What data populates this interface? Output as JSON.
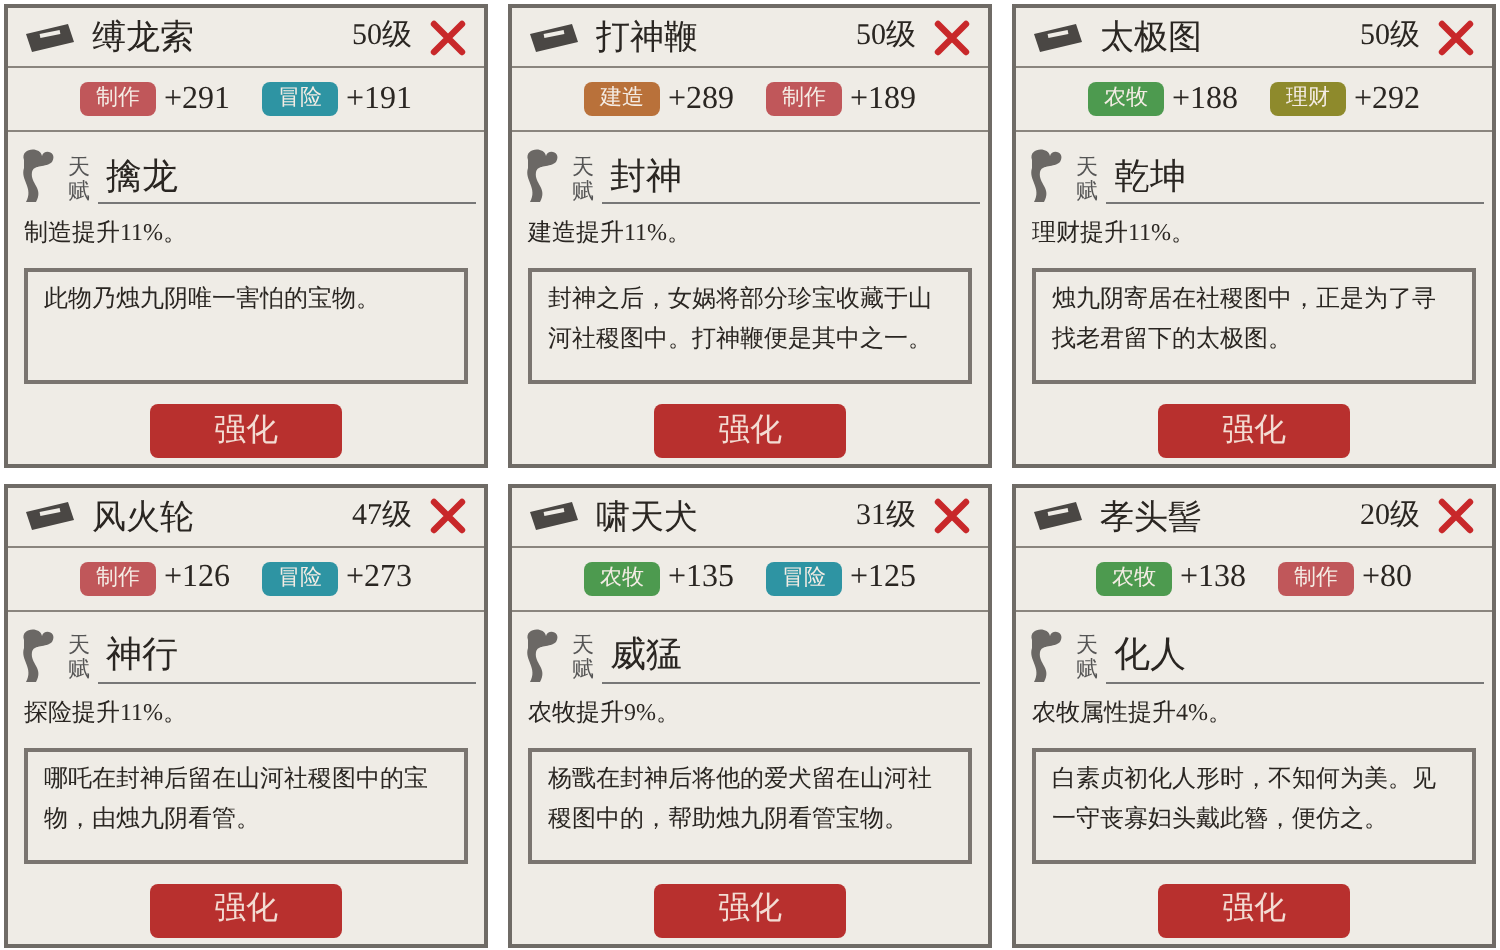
{
  "cards": [
    {
      "name": "缚龙索",
      "level": "50级",
      "tags": [
        {
          "label": "制作",
          "value": "+291",
          "color": "#c0575a"
        },
        {
          "label": "冒险",
          "value": "+191",
          "color": "#2e94a3"
        }
      ],
      "talent_label": "天赋",
      "talent": "擒龙",
      "effect": "制造提升11%。",
      "description": "此物乃烛九阴唯一害怕的宝物。",
      "button": "强化"
    },
    {
      "name": "打神鞭",
      "level": "50级",
      "tags": [
        {
          "label": "建造",
          "value": "+289",
          "color": "#b9713a"
        },
        {
          "label": "制作",
          "value": "+189",
          "color": "#c0575a"
        }
      ],
      "talent_label": "天赋",
      "talent": "封神",
      "effect": "建造提升11%。",
      "description": "封神之后，女娲将部分珍宝收藏于山河社稷图中。打神鞭便是其中之一。",
      "button": "强化"
    },
    {
      "name": "太极图",
      "level": "50级",
      "tags": [
        {
          "label": "农牧",
          "value": "+188",
          "color": "#4d9a4f"
        },
        {
          "label": "理财",
          "value": "+292",
          "color": "#8e8a2c"
        }
      ],
      "talent_label": "天赋",
      "talent": "乾坤",
      "effect": "理财提升11%。",
      "description": "烛九阴寄居在社稷图中，正是为了寻找老君留下的太极图。",
      "button": "强化"
    },
    {
      "name": "风火轮",
      "level": "47级",
      "tags": [
        {
          "label": "制作",
          "value": "+126",
          "color": "#c0575a"
        },
        {
          "label": "冒险",
          "value": "+273",
          "color": "#2e94a3"
        }
      ],
      "talent_label": "天赋",
      "talent": "神行",
      "effect": "探险提升11%。",
      "description": "哪吒在封神后留在山河社稷图中的宝物，由烛九阴看管。",
      "button": "强化"
    },
    {
      "name": "啸天犬",
      "level": "31级",
      "tags": [
        {
          "label": "农牧",
          "value": "+135",
          "color": "#4d9a4f"
        },
        {
          "label": "冒险",
          "value": "+125",
          "color": "#2e94a3"
        }
      ],
      "talent_label": "天赋",
      "talent": "威猛",
      "effect": "农牧提升9%。",
      "description": "杨戬在封神后将他的爱犬留在山河社稷图中的，帮助烛九阴看管宝物。",
      "button": "强化"
    },
    {
      "name": "孝头髻",
      "level": "20级",
      "tags": [
        {
          "label": "农牧",
          "value": "+138",
          "color": "#4d9a4f"
        },
        {
          "label": "制作",
          "value": "+80",
          "color": "#c0575a"
        }
      ],
      "talent_label": "天赋",
      "talent": "化人",
      "effect": "农牧属性提升4%。",
      "description": "白素贞初化人形时，不知何为美。见一守丧寡妇头戴此簪，便仿之。",
      "button": "强化"
    }
  ]
}
